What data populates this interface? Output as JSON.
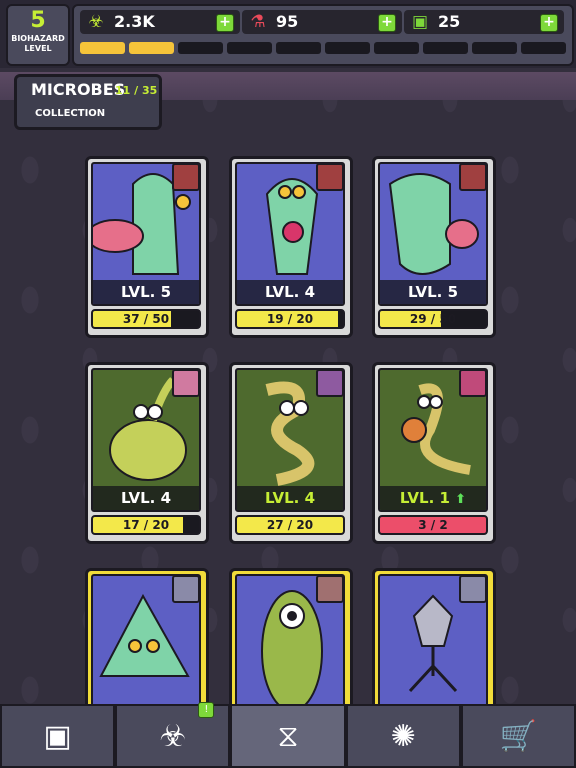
{
  "biohazard": {
    "level": "5",
    "label_line1": "BIOHAZARD",
    "label_line2": "LEVEL"
  },
  "resources": [
    {
      "icon": "biohazard-icon",
      "value": "2.3K"
    },
    {
      "icon": "flask-icon",
      "value": "95"
    },
    {
      "icon": "cash-icon",
      "value": "25"
    }
  ],
  "level_progress": {
    "filled_segments": 2,
    "total_segments": 10
  },
  "header": {
    "title": "MICROBES",
    "count": "11 / 35",
    "subtitle": "COLLECTION"
  },
  "cards": [
    {
      "level_text": "LVL. 5",
      "progress_text": "37 / 50",
      "progress": 0.74
    },
    {
      "level_text": "LVL. 4",
      "progress_text": "19 / 20",
      "progress": 0.95
    },
    {
      "level_text": "LVL. 5",
      "progress_text": "29 / 50",
      "progress": 0.58
    },
    {
      "level_text": "LVL. 4",
      "progress_text": "17 / 20",
      "progress": 0.85
    },
    {
      "level_text": "LVL. 4",
      "progress_text": "27 / 20",
      "progress": 1.0
    },
    {
      "level_text": "LVL. 1",
      "progress_text": "3 / 2",
      "progress": 1.0,
      "upgrade_ready": true
    },
    {
      "level_text": "",
      "progress_text": "",
      "progress": 0
    },
    {
      "level_text": "",
      "progress_text": "",
      "progress": 0
    },
    {
      "level_text": "",
      "progress_text": "",
      "progress": 0
    }
  ],
  "nav": [
    {
      "icon": "ad-icon"
    },
    {
      "icon": "biohazard-icon",
      "badge": "!"
    },
    {
      "icon": "dna-icon"
    },
    {
      "icon": "molecule-icon"
    },
    {
      "icon": "cart-icon"
    }
  ],
  "colors": {
    "accent_green": "#c6ee35",
    "progress_yellow": "#f3e84a",
    "progress_red": "#ec4e6a",
    "card_gold": "#f1dc3a"
  }
}
